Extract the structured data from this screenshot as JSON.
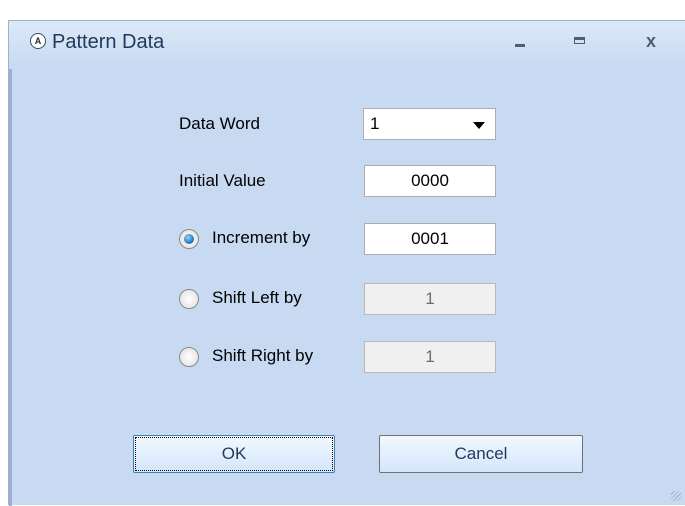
{
  "window": {
    "title": "Pattern Data",
    "icon": "app-icon",
    "close_label": "x"
  },
  "form": {
    "data_word_label": "Data Word",
    "data_word_value": "1",
    "initial_value_label": "Initial Value",
    "initial_value": "0000",
    "options": [
      {
        "label": "Increment by",
        "value": "0001",
        "checked": true,
        "enabled": true
      },
      {
        "label": "Shift Left by",
        "value": "1",
        "checked": false,
        "enabled": false
      },
      {
        "label": "Shift Right by",
        "value": "1",
        "checked": false,
        "enabled": false
      }
    ]
  },
  "buttons": {
    "ok_label": "OK",
    "cancel_label": "Cancel"
  }
}
